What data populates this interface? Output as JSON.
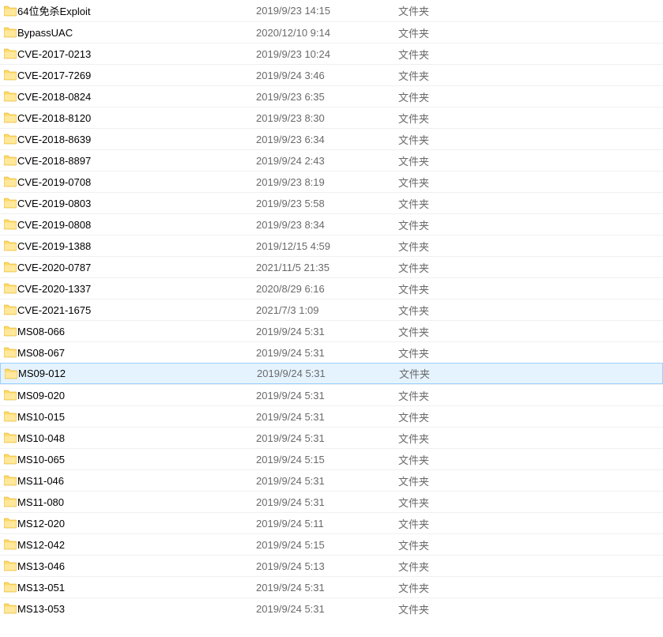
{
  "type_label": "文件夹",
  "items": [
    {
      "name": "64位免杀Exploit",
      "date": "2019/9/23 14:15",
      "selected": false
    },
    {
      "name": "BypassUAC",
      "date": "2020/12/10 9:14",
      "selected": false
    },
    {
      "name": "CVE-2017-0213",
      "date": "2019/9/23 10:24",
      "selected": false
    },
    {
      "name": "CVE-2017-7269",
      "date": "2019/9/24 3:46",
      "selected": false
    },
    {
      "name": "CVE-2018-0824",
      "date": "2019/9/23 6:35",
      "selected": false
    },
    {
      "name": "CVE-2018-8120",
      "date": "2019/9/23 8:30",
      "selected": false
    },
    {
      "name": "CVE-2018-8639",
      "date": "2019/9/23 6:34",
      "selected": false
    },
    {
      "name": "CVE-2018-8897",
      "date": "2019/9/24 2:43",
      "selected": false
    },
    {
      "name": "CVE-2019-0708",
      "date": "2019/9/23 8:19",
      "selected": false
    },
    {
      "name": "CVE-2019-0803",
      "date": "2019/9/23 5:58",
      "selected": false
    },
    {
      "name": "CVE-2019-0808",
      "date": "2019/9/23 8:34",
      "selected": false
    },
    {
      "name": "CVE-2019-1388",
      "date": "2019/12/15 4:59",
      "selected": false
    },
    {
      "name": "CVE-2020-0787",
      "date": "2021/11/5 21:35",
      "selected": false
    },
    {
      "name": "CVE-2020-1337",
      "date": "2020/8/29 6:16",
      "selected": false
    },
    {
      "name": "CVE-2021-1675",
      "date": "2021/7/3 1:09",
      "selected": false
    },
    {
      "name": "MS08-066",
      "date": "2019/9/24 5:31",
      "selected": false
    },
    {
      "name": "MS08-067",
      "date": "2019/9/24 5:31",
      "selected": false
    },
    {
      "name": "MS09-012",
      "date": "2019/9/24 5:31",
      "selected": true
    },
    {
      "name": "MS09-020",
      "date": "2019/9/24 5:31",
      "selected": false
    },
    {
      "name": "MS10-015",
      "date": "2019/9/24 5:31",
      "selected": false
    },
    {
      "name": "MS10-048",
      "date": "2019/9/24 5:31",
      "selected": false
    },
    {
      "name": "MS10-065",
      "date": "2019/9/24 5:15",
      "selected": false
    },
    {
      "name": "MS11-046",
      "date": "2019/9/24 5:31",
      "selected": false
    },
    {
      "name": "MS11-080",
      "date": "2019/9/24 5:31",
      "selected": false
    },
    {
      "name": "MS12-020",
      "date": "2019/9/24 5:11",
      "selected": false
    },
    {
      "name": "MS12-042",
      "date": "2019/9/24 5:15",
      "selected": false
    },
    {
      "name": "MS13-046",
      "date": "2019/9/24 5:13",
      "selected": false
    },
    {
      "name": "MS13-051",
      "date": "2019/9/24 5:31",
      "selected": false
    },
    {
      "name": "MS13-053",
      "date": "2019/9/24 5:31",
      "selected": false
    }
  ]
}
